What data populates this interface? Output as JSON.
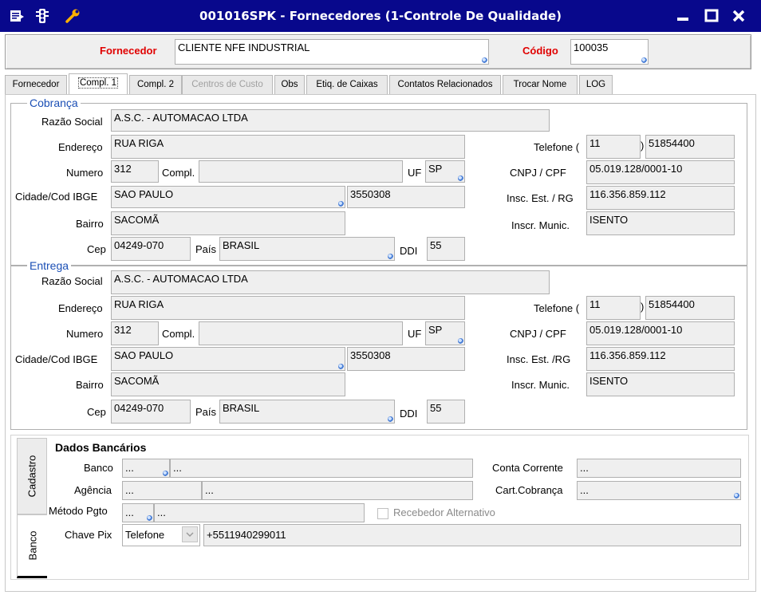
{
  "window": {
    "title": "001016SPK - Fornecedores (1-Controle De Qualidade)",
    "icons": [
      "document-icon",
      "traffic-light-icon",
      "wrench-icon"
    ],
    "controls": [
      "minimize-icon",
      "maximize-icon",
      "close-icon"
    ]
  },
  "header": {
    "fornecedor_label": "Fornecedor",
    "fornecedor_value": "CLIENTE NFE INDUSTRIAL",
    "codigo_label": "Código",
    "codigo_value": "100035"
  },
  "tabs": [
    {
      "label": "Fornecedor",
      "state": "normal"
    },
    {
      "label": "Compl. 1",
      "state": "active"
    },
    {
      "label": "Compl. 2",
      "state": "normal"
    },
    {
      "label": "Centros de Custo",
      "state": "disabled"
    },
    {
      "label": "Obs",
      "state": "normal"
    },
    {
      "label": "Etiq. de Caixas",
      "state": "normal"
    },
    {
      "label": "Contatos Relacionados",
      "state": "normal"
    },
    {
      "label": "Trocar Nome",
      "state": "normal"
    },
    {
      "label": "LOG",
      "state": "normal"
    }
  ],
  "labels": {
    "razao_social": "Razão Social",
    "endereco": "Endereço",
    "numero": "Numero",
    "compl": "Compl.",
    "uf": "UF",
    "cidade": "Cidade/Cod IBGE",
    "bairro": "Bairro",
    "cep": "Cep",
    "pais": "País",
    "ddi": "DDI",
    "telefone": "Telefone (",
    "telefone_close": ")",
    "cnpj": "CNPJ / CPF",
    "insc_est_cobranca": "Insc. Est. / RG",
    "insc_est_entrega": "Insc. Est. /RG",
    "insc_mun_cobranca": "Inscr. Munic.",
    "insc_mun_entrega": "Inscr. Munic."
  },
  "cobranca": {
    "legend": "Cobrança",
    "razao_social": "A.S.C. - AUTOMACAO LTDA",
    "endereco": "RUA RIGA",
    "numero": "312",
    "compl": "",
    "uf": "SP",
    "cidade": "SAO PAULO",
    "cod_ibge": "3550308",
    "bairro": "SACOMÃ",
    "cep": "04249-070",
    "pais": "BRASIL",
    "ddi": "55",
    "ddd": "11",
    "telefone": "51854400",
    "cnpj": "05.019.128/0001-10",
    "insc_est": "116.356.859.112",
    "insc_mun": "ISENTO"
  },
  "entrega": {
    "legend": "Entrega",
    "razao_social": "A.S.C. - AUTOMACAO LTDA",
    "endereco": "RUA RIGA",
    "numero": "312",
    "compl": "",
    "uf": "SP",
    "cidade": "SAO PAULO",
    "cod_ibge": "3550308",
    "bairro": "SACOMÃ",
    "cep": "04249-070",
    "pais": "BRASIL",
    "ddi": "55",
    "ddd": "11",
    "telefone": "51854400",
    "cnpj": "05.019.128/0001-10",
    "insc_est": "116.356.859.112",
    "insc_mun": "ISENTO"
  },
  "side_tabs": [
    {
      "label": "Cadastro",
      "state": "normal"
    },
    {
      "label": "Banco",
      "state": "active"
    }
  ],
  "bancario": {
    "title": "Dados Bancários",
    "banco_label": "Banco",
    "banco_code": "...",
    "banco_name": "...",
    "agencia_label": "Agência",
    "agencia_code": "...",
    "agencia_name": "...",
    "metodo_label": "Método Pgto",
    "metodo_code": "...",
    "metodo_name": "...",
    "pix_label": "Chave Pix",
    "pix_type": "Telefone",
    "pix_value": "+5511940299011",
    "conta_label": "Conta Corrente",
    "conta_value": "...",
    "cart_label": "Cart.Cobrança",
    "cart_value": "...",
    "recebedor_label": "Recebedor Alternativo",
    "recebedor_checked": false
  }
}
